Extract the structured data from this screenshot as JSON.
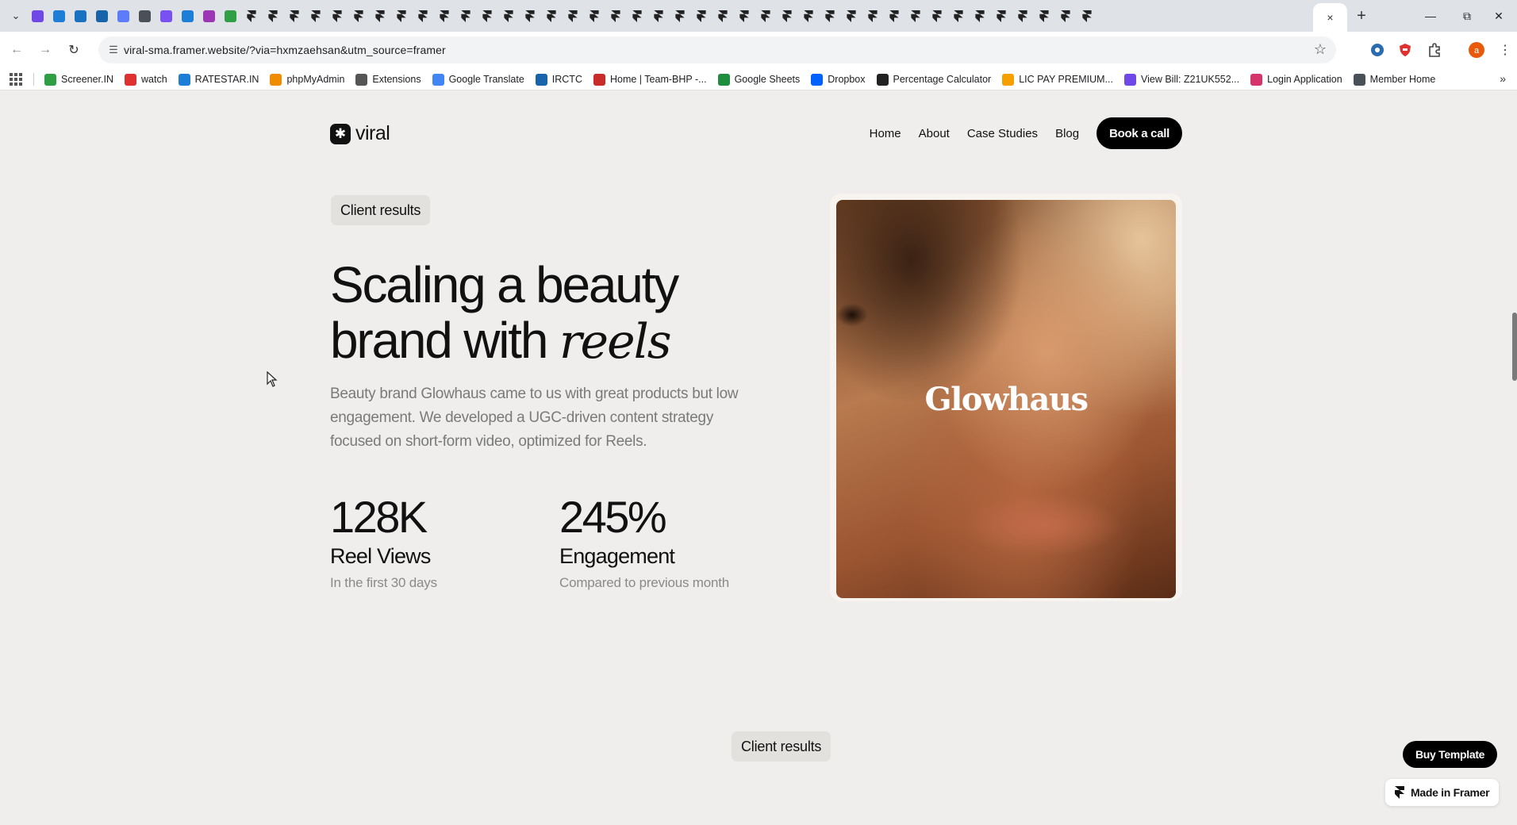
{
  "browser": {
    "url": "viral-sma.framer.website/?via=hxmzaehsan&utm_source=framer",
    "close_tab_glyph": "×",
    "new_tab_glyph": "+",
    "pinned_tab_count": 50,
    "bookmarks": [
      {
        "label": "Screener.IN",
        "color": "#2f9e44"
      },
      {
        "label": "watch",
        "color": "#e03131"
      },
      {
        "label": "RATESTAR.IN",
        "color": "#1c7ed6"
      },
      {
        "label": "phpMyAdmin",
        "color": "#f08c00"
      },
      {
        "label": "Extensions",
        "color": "#555555"
      },
      {
        "label": "Google Translate",
        "color": "#4285f4"
      },
      {
        "label": "IRCTC",
        "color": "#1864ab"
      },
      {
        "label": "Home | Team-BHP -...",
        "color": "#c92a2a"
      },
      {
        "label": "Google Sheets",
        "color": "#1e8e3e"
      },
      {
        "label": "Dropbox",
        "color": "#0061fe"
      },
      {
        "label": "Percentage Calculator",
        "color": "#222222"
      },
      {
        "label": "LIC PAY PREMIUM...",
        "color": "#f59f00"
      },
      {
        "label": "View Bill: Z21UK552...",
        "color": "#7048e8"
      },
      {
        "label": "Login Application",
        "color": "#d6336c"
      },
      {
        "label": "Member Home",
        "color": "#495057"
      }
    ],
    "more_glyph": "»"
  },
  "site": {
    "logo_text": "viral",
    "nav": {
      "home": "Home",
      "about": "About",
      "case_studies": "Case Studies",
      "blog": "Blog",
      "cta": "Book a call"
    },
    "hero": {
      "badge": "Client results",
      "headline_line1": "Scaling a beauty",
      "headline_line2_plain": "brand with ",
      "headline_line2_italic": "reels",
      "description": "Beauty brand Glowhaus came to us with great products but low engagement. We developed a UGC-driven content strategy focused on short-form video, optimized for Reels.",
      "image_brand": "Glowhaus"
    },
    "stats": [
      {
        "value": "128K",
        "label": "Reel Views",
        "sub": "In the first 30 days"
      },
      {
        "value": "245%",
        "label": "Engagement",
        "sub": "Compared to previous month"
      }
    ],
    "next_badge": "Client results",
    "buy_template": "Buy Template",
    "made_in_framer": "Made in Framer"
  }
}
